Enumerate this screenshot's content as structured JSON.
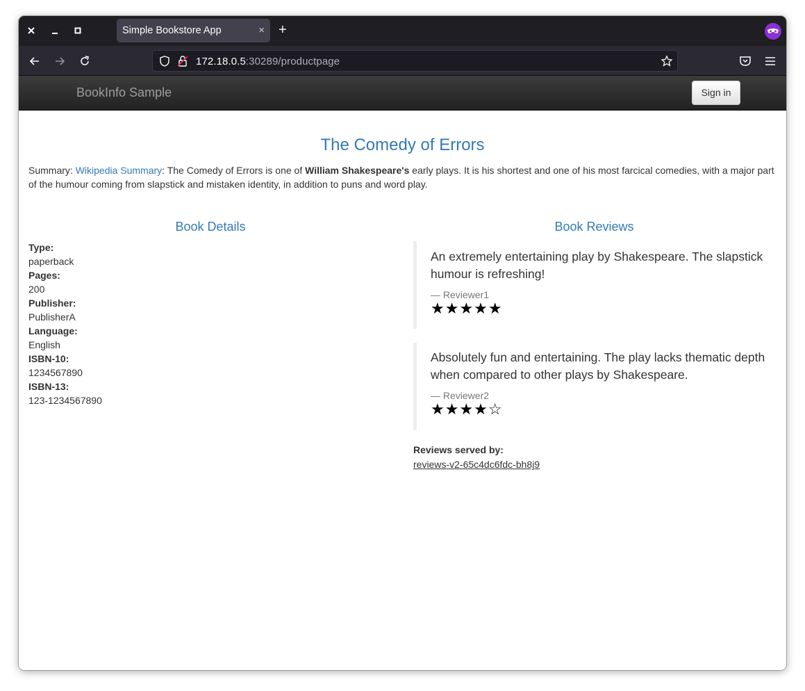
{
  "browser": {
    "tab_title": "Simple Bookstore App",
    "tab_close": "×",
    "new_tab": "+",
    "url_host": "172.18.0.5",
    "url_rest": ":30289/productpage",
    "window_controls": [
      "close-icon",
      "minimize-icon",
      "maximize-icon"
    ]
  },
  "header": {
    "brand": "BookInfo Sample",
    "signin_label": "Sign in"
  },
  "book": {
    "title": "The Comedy of Errors",
    "summary_label": "Summary: ",
    "summary_link": "Wikipedia Summary",
    "summary_text_1": ": The Comedy of Errors is one of ",
    "summary_bold": "William Shakespeare's",
    "summary_text_2": " early plays. It is his shortest and one of his most farcical comedies, with a major part of the humour coming from slapstick and mistaken identity, in addition to puns and word play."
  },
  "details": {
    "heading": "Book Details",
    "items": [
      {
        "label": "Type:",
        "value": "paperback"
      },
      {
        "label": "Pages:",
        "value": "200"
      },
      {
        "label": "Publisher:",
        "value": "PublisherA"
      },
      {
        "label": "Language:",
        "value": "English"
      },
      {
        "label": "ISBN-10:",
        "value": "1234567890"
      },
      {
        "label": "ISBN-13:",
        "value": "123-1234567890"
      }
    ]
  },
  "reviews": {
    "heading": "Book Reviews",
    "items": [
      {
        "text": "An extremely entertaining play by Shakespeare. The slapstick humour is refreshing!",
        "reviewer": "— Reviewer1",
        "stars": "★★★★★",
        "rating": 5
      },
      {
        "text": "Absolutely fun and entertaining. The play lacks thematic depth when compared to other plays by Shakespeare.",
        "reviewer": "— Reviewer2",
        "stars": "★★★★☆",
        "rating": 4
      }
    ],
    "served_by_label": "Reviews served by:",
    "served_by_value": "reviews-v2-65c4dc6fdc-bh8j9"
  },
  "colors": {
    "accent": "#337ab7",
    "toolbar": "#2b2a33",
    "tabstrip": "#1f1e22",
    "private_icon": "#8b2fd6"
  }
}
